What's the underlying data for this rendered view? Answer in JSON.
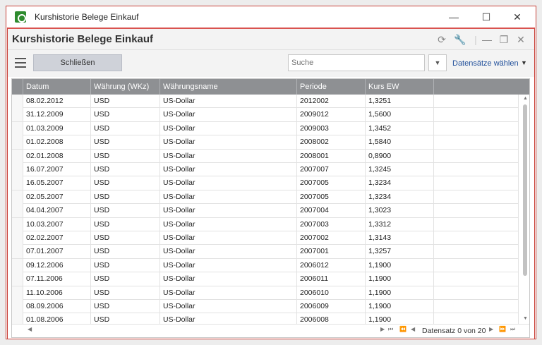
{
  "window": {
    "title": "Kurshistorie Belege Einkauf",
    "minimize_icon": "minimize-icon",
    "maximize_icon": "maximize-icon",
    "close_icon": "close-icon"
  },
  "header": {
    "title": "Kurshistorie Belege Einkauf"
  },
  "toolbar": {
    "close_label": "Schließen",
    "search_placeholder": "Suche",
    "records_label": "Datensätze wählen"
  },
  "grid": {
    "columns": [
      "Datum",
      "Währung (WKz)",
      "Währungsname",
      "Periode",
      "Kurs EW"
    ],
    "rows": [
      [
        "08.02.2012",
        "USD",
        "US-Dollar",
        "2012002",
        "1,3251"
      ],
      [
        "31.12.2009",
        "USD",
        "US-Dollar",
        "2009012",
        "1,5600"
      ],
      [
        "01.03.2009",
        "USD",
        "US-Dollar",
        "2009003",
        "1,3452"
      ],
      [
        "01.02.2008",
        "USD",
        "US-Dollar",
        "2008002",
        "1,5840"
      ],
      [
        "02.01.2008",
        "USD",
        "US-Dollar",
        "2008001",
        "0,8900"
      ],
      [
        "16.07.2007",
        "USD",
        "US-Dollar",
        "2007007",
        "1,3245"
      ],
      [
        "16.05.2007",
        "USD",
        "US-Dollar",
        "2007005",
        "1,3234"
      ],
      [
        "02.05.2007",
        "USD",
        "US-Dollar",
        "2007005",
        "1,3234"
      ],
      [
        "04.04.2007",
        "USD",
        "US-Dollar",
        "2007004",
        "1,3023"
      ],
      [
        "10.03.2007",
        "USD",
        "US-Dollar",
        "2007003",
        "1,3312"
      ],
      [
        "02.02.2007",
        "USD",
        "US-Dollar",
        "2007002",
        "1,3143"
      ],
      [
        "07.01.2007",
        "USD",
        "US-Dollar",
        "2007001",
        "1,3257"
      ],
      [
        "09.12.2006",
        "USD",
        "US-Dollar",
        "2006012",
        "1,1900"
      ],
      [
        "07.11.2006",
        "USD",
        "US-Dollar",
        "2006011",
        "1,1900"
      ],
      [
        "11.10.2006",
        "USD",
        "US-Dollar",
        "2006010",
        "1,1900"
      ],
      [
        "08.09.2006",
        "USD",
        "US-Dollar",
        "2006009",
        "1,1900"
      ],
      [
        "01.08.2006",
        "USD",
        "US-Dollar",
        "2006008",
        "1,1900"
      ]
    ]
  },
  "footer": {
    "record_status": "Datensatz 0 von 20"
  },
  "colors": {
    "accent_border": "#c9423a",
    "grid_header": "#8e9093",
    "link": "#1f4e9a"
  }
}
